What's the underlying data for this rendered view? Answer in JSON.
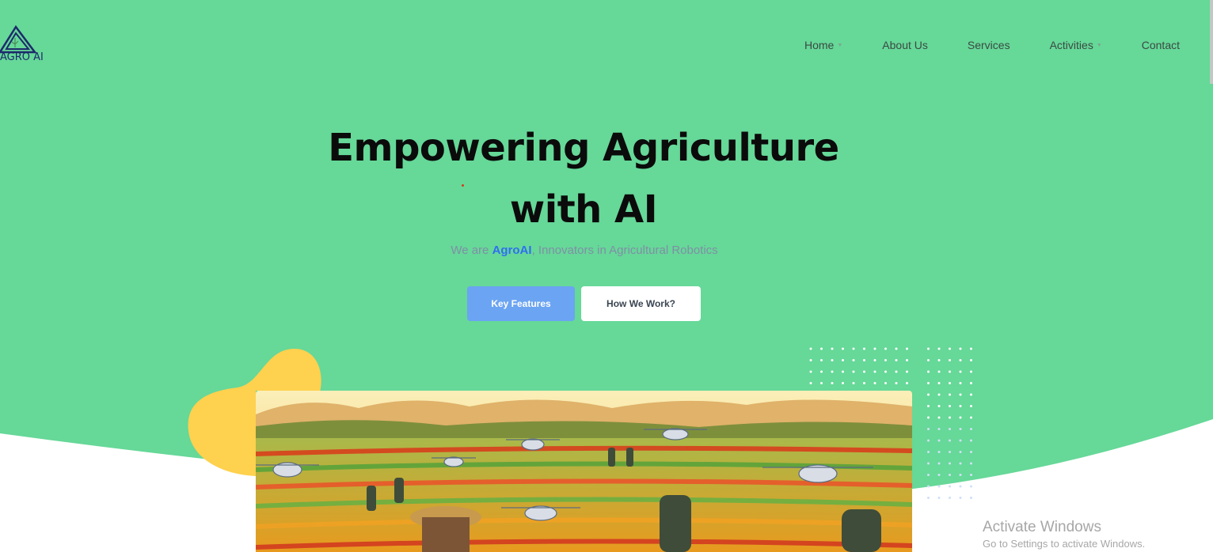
{
  "logo": {
    "text": "AGRO AI",
    "icon": "triangle-leaf-logo"
  },
  "nav": {
    "items": [
      {
        "label": "Home",
        "has_dropdown": true
      },
      {
        "label": "About Us",
        "has_dropdown": false
      },
      {
        "label": "Services",
        "has_dropdown": false
      },
      {
        "label": "Activities",
        "has_dropdown": true
      },
      {
        "label": "Contact",
        "has_dropdown": false
      }
    ]
  },
  "hero": {
    "headline_line1": "Empowering Agriculture",
    "headline_line2": "with AI",
    "tagline_prefix": "We are ",
    "tagline_brand": "AgroAI",
    "tagline_suffix": ", Innovators in Agricultural Robotics",
    "primary_button": "Key Features",
    "secondary_button": "How We Work?"
  },
  "watermark": {
    "title": "Activate Windows",
    "subtitle": "Go to Settings to activate Windows."
  },
  "colors": {
    "hero_green": "#66d898",
    "accent_blue": "#6ba4f2",
    "blob_yellow": "#fed14e",
    "brand_blue": "#2f6ff0"
  }
}
